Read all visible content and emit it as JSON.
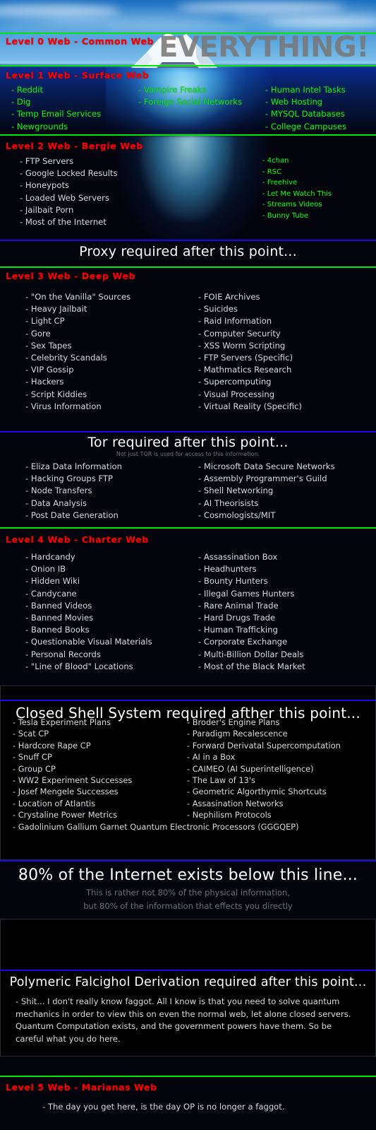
{
  "poster": {
    "banner_text": "EVERYTHING!"
  },
  "levels": [
    {
      "id": "level0",
      "title": "Level 0 Web - Common Web",
      "columns": []
    },
    {
      "id": "level1",
      "title": "Level 1 Web - Surface Web",
      "columns": [
        [
          "- Reddit",
          "- Dig",
          "- Temp Email Services",
          "- Newgrounds"
        ],
        [
          "- Vampire Freaks",
          "- Foreign Social Networks"
        ],
        [
          "- Human Intel Tasks",
          "- Web Hosting",
          "- MYSQL Databases",
          "- College Campuses"
        ]
      ]
    },
    {
      "id": "level2",
      "title": "Level 2 Web - Bergie Web",
      "columns": [
        [
          "- FTP Servers",
          "- Google Locked Results",
          "- Honeypots",
          "- Loaded Web Servers",
          "- Jailbait Porn",
          "- Most of the Internet"
        ],
        [
          "- 4chan",
          "- RSC",
          "- Freehive",
          "- Let Me Watch This",
          "- Streams Videos",
          "- Bunny Tube"
        ]
      ]
    },
    {
      "id": "level3",
      "title": "Level 3 Web - Deep Web",
      "columns": [
        [
          "- \"On the Vanilla\" Sources",
          "- Heavy Jailbait",
          "- Light CP",
          "- Gore",
          "- Sex Tapes",
          "- Celebrity Scandals",
          "- VIP Gossip",
          "- Hackers",
          "- Script Kiddies",
          "- Virus Information"
        ],
        [
          "- FOIE Archives",
          "- Suicides",
          "- Raid Information",
          "- Computer Security",
          "- XSS Worm Scripting",
          "- FTP Servers (Specific)",
          "- Mathmatics Research",
          "- Supercomputing",
          "- Visual Processing",
          "- Virtual Reality (Specific)"
        ]
      ]
    },
    {
      "id": "level4",
      "title": "Level 4 Web - Charter Web",
      "columns": [
        [
          "- Hardcandy",
          "- Onion IB",
          "- Hidden Wiki",
          "- Candycane",
          "- Banned Videos",
          "- Banned Movies",
          "- Banned Books",
          "- Questionable Visual Materials",
          "- Personal Records",
          "- \"Line of Blood\" Locations"
        ],
        [
          "- Assassination Box",
          "- Headhunters",
          "- Bounty Hunters",
          "- Illegal Games Hunters",
          "- Rare Animal Trade",
          "- Hard Drugs Trade",
          "- Human Trafficking",
          "- Corporate Exchange",
          "- Multi-Billion Dollar Deals",
          "- Most of the Black Market"
        ]
      ]
    },
    {
      "id": "level5",
      "title": "Level 5 Web - Marianas Web",
      "columns": [
        [
          "- The day you get here, is the day OP is no longer a faggot."
        ]
      ]
    }
  ],
  "gates": [
    {
      "id": "proxy",
      "heading": "Proxy required after this point...",
      "subheading": "",
      "columns": []
    },
    {
      "id": "tor",
      "heading": "Tor required after this point...",
      "subheading": "Not just TOR is used for access to this information.",
      "columns": [
        [
          "- Eliza Data Information",
          "- Hacking Groups FTP",
          "- Node Transfers",
          "- Data Analysis",
          "- Post Date Generation"
        ],
        [
          "- Microsoft Data Secure Networks",
          "- Assembly Programmer's Guild",
          "- Shell Networking",
          "- AI Theorisists",
          "- Cosmologists/MIT"
        ]
      ]
    },
    {
      "id": "closed-shell",
      "heading": "Closed Shell System required afther this point...",
      "subheading": "",
      "columns": [
        [
          "- Tesla Experiment Plans",
          "- Scat CP",
          "- Hardcore Rape CP",
          "- Snuff CP",
          "- Group CP",
          "- WW2 Experiment Successes",
          "- Josef Mengele Successes",
          "- Location of Atlantis",
          "- Crystaline Power Metrics"
        ],
        [
          "- Broder's Engine Plans",
          "- Paradigm Recalescence",
          "- Forward Derivatal Supercomputation",
          "- AI in a Box",
          "- CAIMEO (AI Superintelligence)",
          "- The Law of 13's",
          "- Geometric Algorthymic Shortcuts",
          "- Assasination Networks",
          "- Nephilism Protocols"
        ]
      ],
      "full_width_item": "- Gadolinium Gallium Garnet Quantum Electronic Processors (GGGQEP)"
    },
    {
      "id": "eighty-percent",
      "heading": "80% of the Internet exists below this line...",
      "sub_line_1": "This is rather not 80% of the physical information,",
      "sub_line_2": "but 80% of the information that effects you directly",
      "columns": []
    },
    {
      "id": "polymeric",
      "heading": "Polymeric Falcighol Derivation required after this point...",
      "body": "- Shit... I don't really know faggot. All I know is that you need to solve quantum mechanics in order to view this on even the normal web, let alone closed servers. Quantum Computation exists, and the government powers have them. So be careful what you do here.",
      "columns": []
    }
  ],
  "colors": {
    "level_title": "#fd0000",
    "divider_green": "#00e808",
    "divider_blue": "#1808f0",
    "list_text": "#d8d8de",
    "list_text_green": "#16e516",
    "gate_text": "#ffffff",
    "banner_text": "#787878",
    "background": "#04040c"
  }
}
